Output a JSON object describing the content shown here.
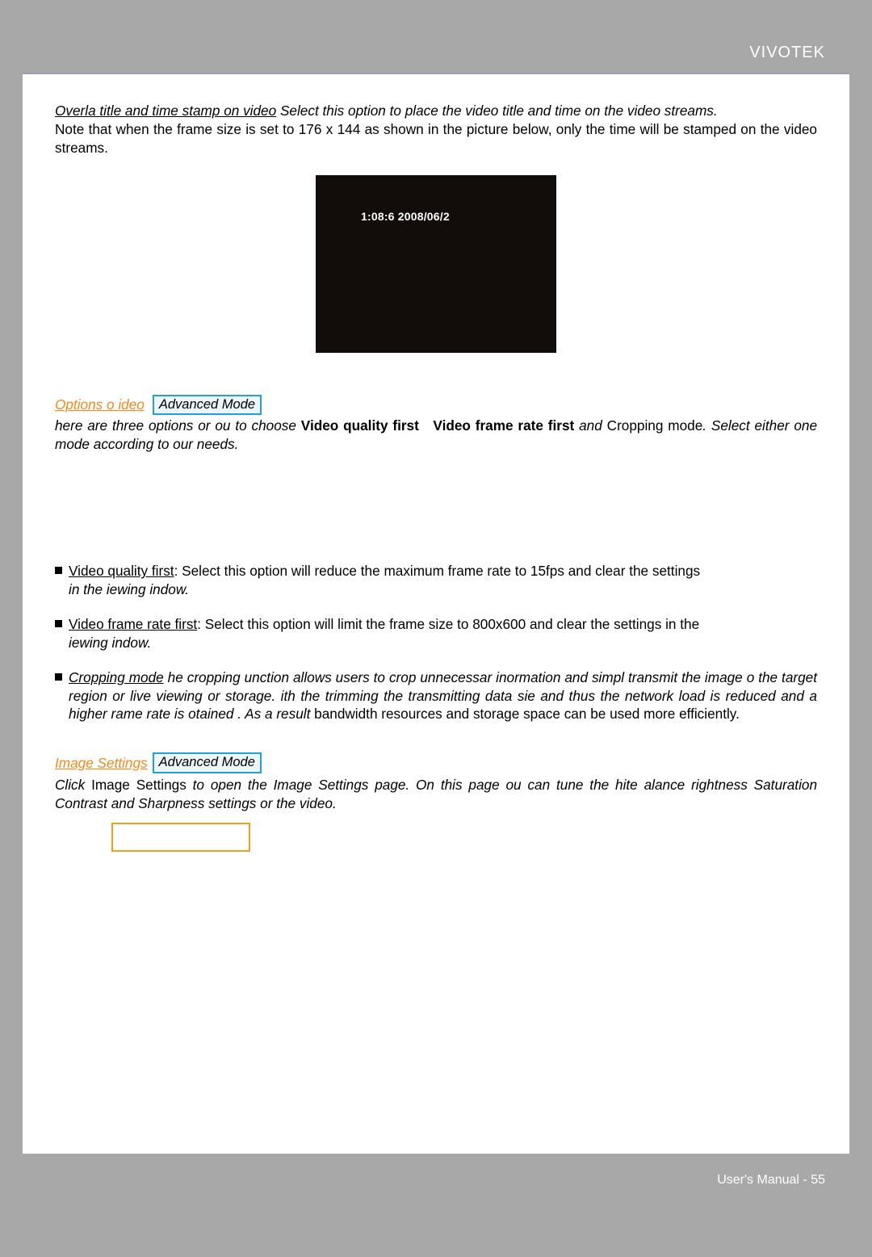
{
  "brand": "VIVOTEK",
  "overlay": {
    "head": "Overla title and time stamp on video",
    "body": " Select this option to place the video title and time on the video streams.",
    "note": "Note that when the frame size is set to 176 x 144 as shown in the picture below, only the time will be stamped on the video streams."
  },
  "preview": {
    "timestamp": "1:08:6 2008/06/2"
  },
  "section1": {
    "link": "Options o ideo",
    "badge": "Advanced Mode",
    "line_a": "here are three options or ou to choose ",
    "line_b1": "Video quality first",
    "line_b2": "Video frame rate first",
    "line_and": " and ",
    "line_c": "Cropping mode",
    "line_d": ". Select either one mode according to our needs."
  },
  "bullets": {
    "b1_head": "Video quality first",
    "b1_tail": ": Select this option will reduce the maximum frame rate to 15fps and clear the settings",
    "b1_it": "in the iewing indow.",
    "b2_head": "Video frame rate first",
    "b2_tail": ": Select this option will limit the frame size to 800x600 and clear the settings in the",
    "b2_it": "iewing indow.",
    "b3_head": "Cropping mode",
    "b3_it1": " he cropping unction allows users to crop unnecessar inormation and simpl transmit the image o the target region or live viewing or storage. ith the trimming the transmitting data sie and thus the network load is reduced and a higher rame rate is otained",
    "b3_it2": " . As a result",
    "b3_plain": "bandwidth resources and storage space can be used more efficiently."
  },
  "section2": {
    "link": "Image Settings",
    "badge": "Advanced Mode",
    "pre": "Click ",
    "mid": "Image Settings",
    "post": " to open the Image Settings page. On this page ou can tune the hite alance rightness Saturation Contrast and Sharpness settings or the video."
  },
  "footer": {
    "label": "User's Manual - ",
    "page": "55"
  }
}
